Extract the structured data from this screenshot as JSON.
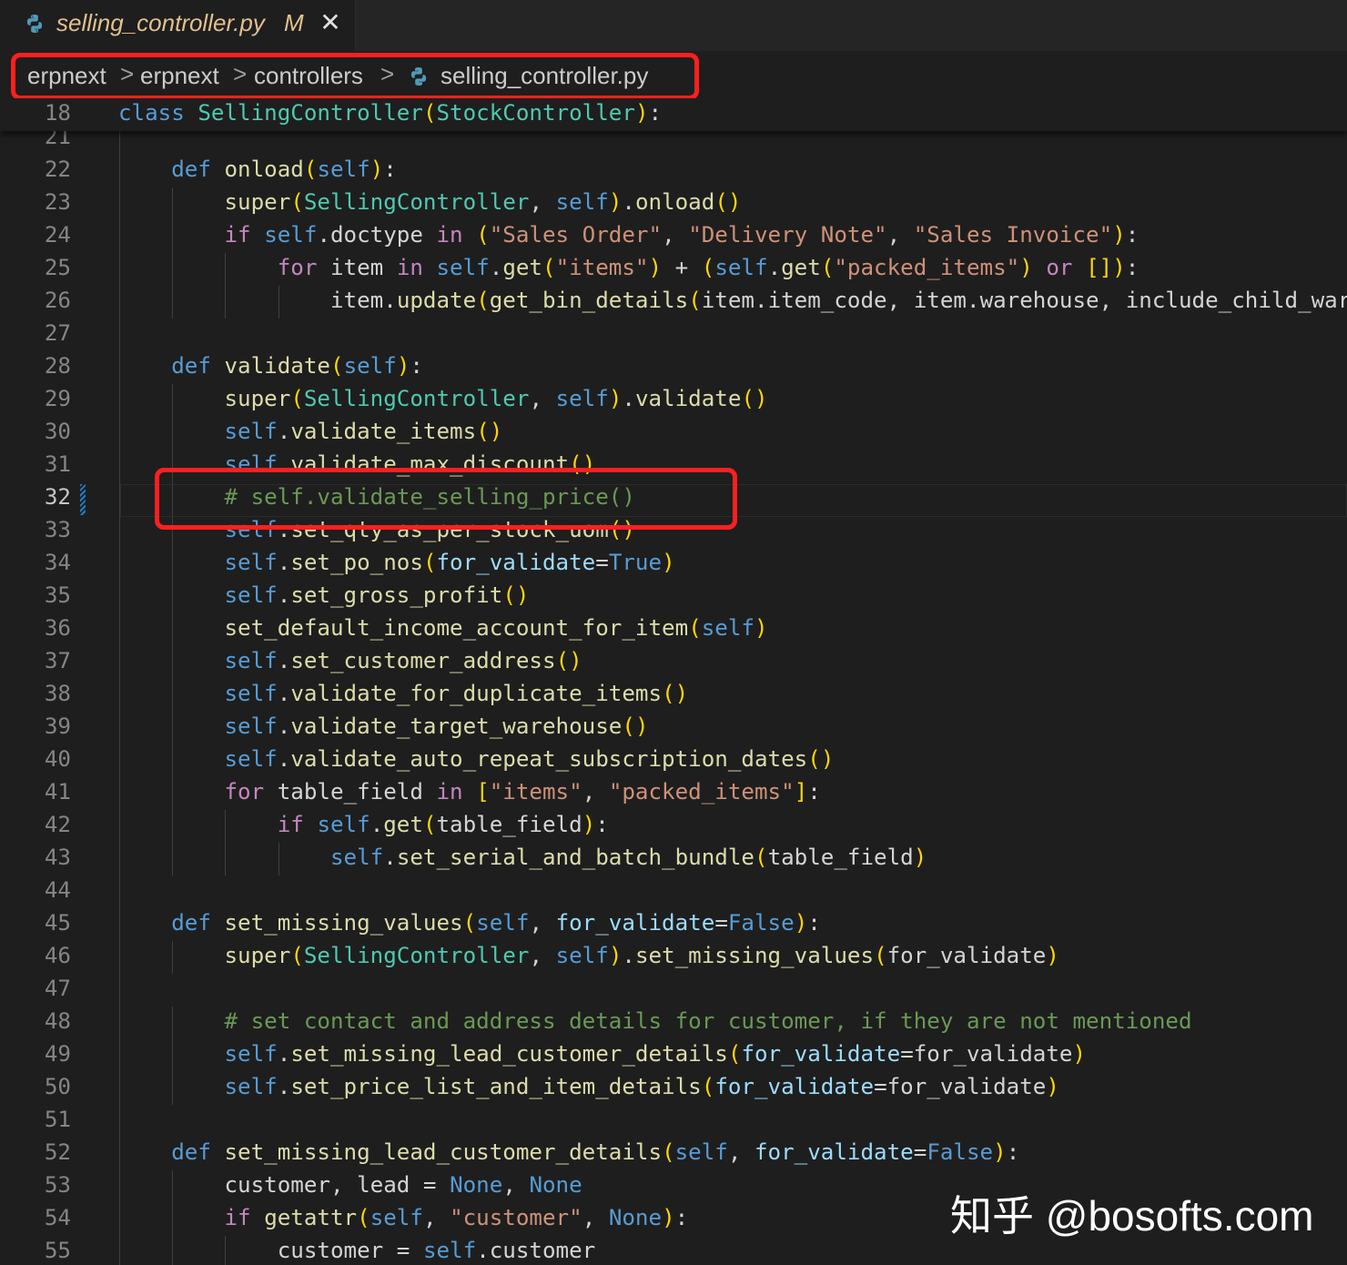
{
  "tab": {
    "filename": "selling_controller.py",
    "modified": "M",
    "close_glyph": "✕",
    "icon": "python-file-icon"
  },
  "breadcrumb": {
    "segments": [
      "erpnext",
      "erpnext",
      "controllers",
      "selling_controller.py"
    ],
    "separator": ">"
  },
  "editor": {
    "active_line": 32,
    "sticky": {
      "line": "18",
      "code": "class SellingController(StockController):"
    },
    "lines": [
      {
        "n": "21",
        "code": ""
      },
      {
        "n": "22",
        "code": "    def onload(self):"
      },
      {
        "n": "23",
        "code": "        super(SellingController, self).onload()"
      },
      {
        "n": "24",
        "code": "        if self.doctype in (\"Sales Order\", \"Delivery Note\", \"Sales Invoice\"):"
      },
      {
        "n": "25",
        "code": "            for item in self.get(\"items\") + (self.get(\"packed_items\") or []):"
      },
      {
        "n": "26",
        "code": "                item.update(get_bin_details(item.item_code, item.warehouse, include_child_ware"
      },
      {
        "n": "27",
        "code": ""
      },
      {
        "n": "28",
        "code": "    def validate(self):"
      },
      {
        "n": "29",
        "code": "        super(SellingController, self).validate()"
      },
      {
        "n": "30",
        "code": "        self.validate_items()"
      },
      {
        "n": "31",
        "code": "        self.validate_max_discount()"
      },
      {
        "n": "32",
        "code": "        # self.validate_selling_price()"
      },
      {
        "n": "33",
        "code": "        self.set_qty_as_per_stock_uom()"
      },
      {
        "n": "34",
        "code": "        self.set_po_nos(for_validate=True)"
      },
      {
        "n": "35",
        "code": "        self.set_gross_profit()"
      },
      {
        "n": "36",
        "code": "        set_default_income_account_for_item(self)"
      },
      {
        "n": "37",
        "code": "        self.set_customer_address()"
      },
      {
        "n": "38",
        "code": "        self.validate_for_duplicate_items()"
      },
      {
        "n": "39",
        "code": "        self.validate_target_warehouse()"
      },
      {
        "n": "40",
        "code": "        self.validate_auto_repeat_subscription_dates()"
      },
      {
        "n": "41",
        "code": "        for table_field in [\"items\", \"packed_items\"]:"
      },
      {
        "n": "42",
        "code": "            if self.get(table_field):"
      },
      {
        "n": "43",
        "code": "                self.set_serial_and_batch_bundle(table_field)"
      },
      {
        "n": "44",
        "code": ""
      },
      {
        "n": "45",
        "code": "    def set_missing_values(self, for_validate=False):"
      },
      {
        "n": "46",
        "code": "        super(SellingController, self).set_missing_values(for_validate)"
      },
      {
        "n": "47",
        "code": ""
      },
      {
        "n": "48",
        "code": "        # set contact and address details for customer, if they are not mentioned"
      },
      {
        "n": "49",
        "code": "        self.set_missing_lead_customer_details(for_validate=for_validate)"
      },
      {
        "n": "50",
        "code": "        self.set_price_list_and_item_details(for_validate=for_validate)"
      },
      {
        "n": "51",
        "code": ""
      },
      {
        "n": "52",
        "code": "    def set_missing_lead_customer_details(self, for_validate=False):"
      },
      {
        "n": "53",
        "code": "        customer, lead = None, None"
      },
      {
        "n": "54",
        "code": "        if getattr(self, \"customer\", None):"
      },
      {
        "n": "55",
        "code": "            customer = self.customer"
      }
    ]
  },
  "colors": {
    "background": "#1e1e1e",
    "highlight_box": "#ff1f1f",
    "modified_tab": "#e2c08d"
  },
  "watermark": "知乎 @bosofts.com"
}
